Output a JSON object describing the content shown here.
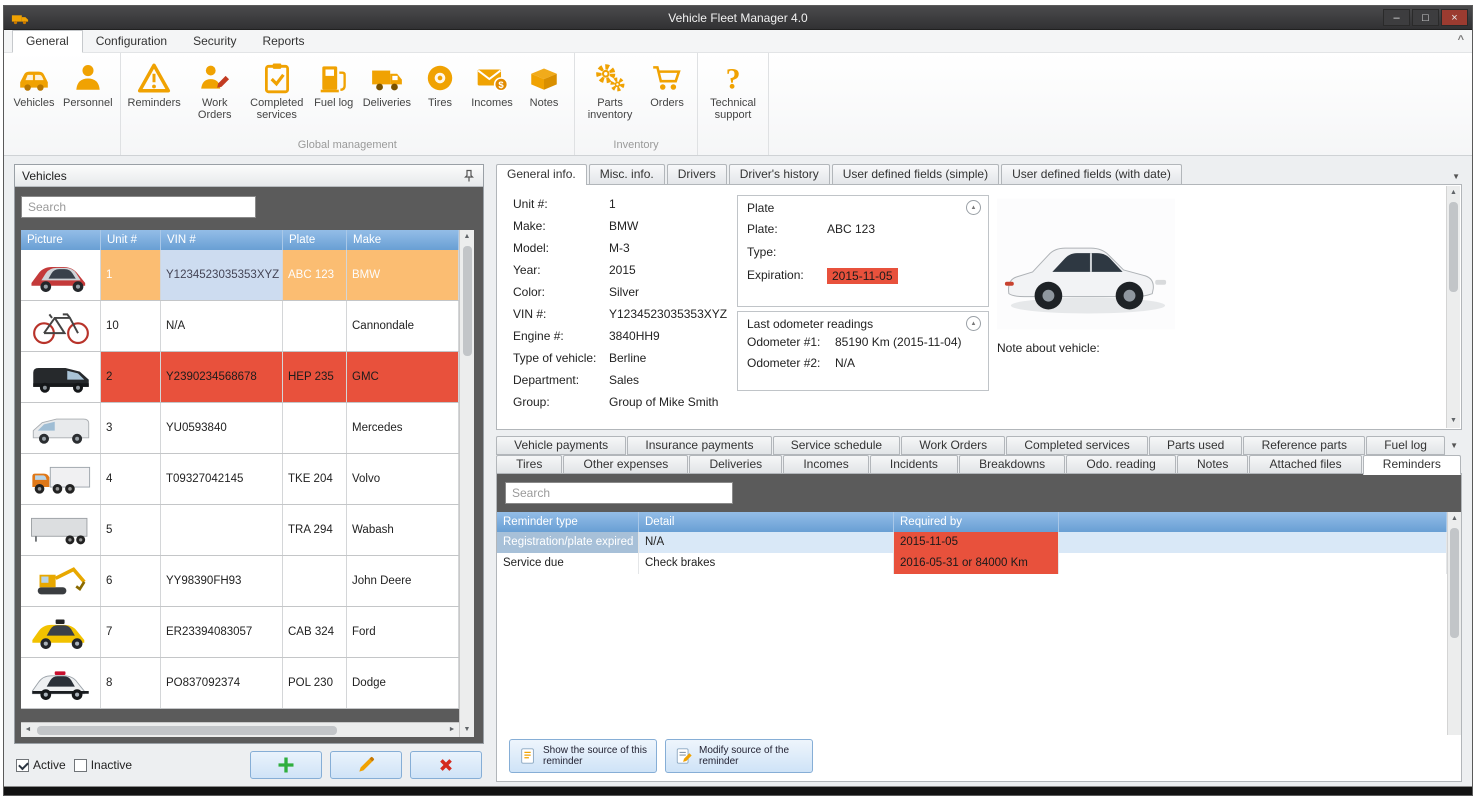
{
  "icons": {
    "chevron_up": "^",
    "dropdown": "▼",
    "scroll_up": "▲",
    "scroll_down": "▼",
    "scroll_left": "◄",
    "scroll_right": "►",
    "collapse_up": "▲"
  },
  "colors": {
    "accent_orange": "#F0A202",
    "alert_red": "#E8513C",
    "selection_orange": "#FBBD72",
    "header_blue": "#74A9DC",
    "selected_row_blue": "#D9E8F7"
  },
  "window": {
    "title": "Vehicle Fleet Manager 4.0",
    "controls": {
      "minimize": "–",
      "maximize": "□",
      "close": "×"
    }
  },
  "menu": {
    "tabs": [
      {
        "label": "General",
        "active": true
      },
      {
        "label": "Configuration",
        "active": false
      },
      {
        "label": "Security",
        "active": false
      },
      {
        "label": "Reports",
        "active": false
      }
    ]
  },
  "ribbon": {
    "groups": [
      {
        "label": "",
        "buttons": [
          {
            "label": "Vehicles",
            "icon": "car"
          },
          {
            "label": "Personnel",
            "icon": "person"
          }
        ]
      },
      {
        "label": "Global management",
        "buttons": [
          {
            "label": "Reminders",
            "icon": "warning"
          },
          {
            "label": "Work Orders",
            "icon": "work-orders"
          },
          {
            "label": "Completed services",
            "icon": "clipboard-check"
          },
          {
            "label": "Fuel log",
            "icon": "fuel-pump"
          },
          {
            "label": "Deliveries",
            "icon": "delivery-truck"
          },
          {
            "label": "Tires",
            "icon": "tire"
          },
          {
            "label": "Incomes",
            "icon": "income"
          },
          {
            "label": "Notes",
            "icon": "note"
          }
        ]
      },
      {
        "label": "Inventory",
        "buttons": [
          {
            "label": "Parts inventory",
            "icon": "gears"
          },
          {
            "label": "Orders",
            "icon": "cart"
          }
        ]
      },
      {
        "label": "",
        "buttons": [
          {
            "label": "Technical support",
            "icon": "question"
          }
        ]
      }
    ]
  },
  "vehicles_panel": {
    "title": "Vehicles",
    "search_placeholder": "Search",
    "columns": [
      "Picture",
      "Unit #",
      "VIN #",
      "Plate",
      "Make"
    ],
    "rows": [
      {
        "unit": "1",
        "vin": "Y1234523035353XYZ",
        "plate": "ABC 123",
        "make": "BMW",
        "state": "selected",
        "icon": "t-car"
      },
      {
        "unit": "10",
        "vin": "N/A",
        "plate": "",
        "make": "Cannondale",
        "state": "normal",
        "icon": "t-bike"
      },
      {
        "unit": "2",
        "vin": "Y2390234568678",
        "plate": "HEP 235",
        "make": "GMC",
        "state": "alert",
        "icon": "t-van-dark"
      },
      {
        "unit": "3",
        "vin": "YU0593840",
        "plate": "",
        "make": "Mercedes",
        "state": "normal",
        "icon": "t-van-white"
      },
      {
        "unit": "4",
        "vin": "T09327042145",
        "plate": "TKE 204",
        "make": "Volvo",
        "state": "normal",
        "icon": "t-truck"
      },
      {
        "unit": "5",
        "vin": "",
        "plate": "TRA 294",
        "make": "Wabash",
        "state": "normal",
        "icon": "t-trailer"
      },
      {
        "unit": "6",
        "vin": "YY98390FH93",
        "plate": "",
        "make": "John Deere",
        "state": "normal",
        "icon": "t-excavator"
      },
      {
        "unit": "7",
        "vin": "ER23394083057",
        "plate": "CAB 324",
        "make": "Ford",
        "state": "normal",
        "icon": "t-taxi"
      },
      {
        "unit": "8",
        "vin": "PO837092374",
        "plate": "POL 230",
        "make": "Dodge",
        "state": "normal",
        "icon": "t-police"
      }
    ],
    "filters": {
      "active_label": "Active",
      "inactive_label": "Inactive",
      "active_checked": true,
      "inactive_checked": false
    }
  },
  "detail_tabs": [
    {
      "label": "General info.",
      "active": true
    },
    {
      "label": "Misc. info.",
      "active": false
    },
    {
      "label": "Drivers",
      "active": false
    },
    {
      "label": "Driver's history",
      "active": false
    },
    {
      "label": "User defined fields (simple)",
      "active": false
    },
    {
      "label": "User defined fields (with date)",
      "active": false
    }
  ],
  "general_info": {
    "fields": [
      {
        "label": "Unit #:",
        "value": "1"
      },
      {
        "label": "Make:",
        "value": "BMW"
      },
      {
        "label": "Model:",
        "value": "M-3"
      },
      {
        "label": "Year:",
        "value": "2015"
      },
      {
        "label": "Color:",
        "value": "Silver"
      },
      {
        "label": "VIN #:",
        "value": "Y1234523035353XYZ"
      },
      {
        "label": "Engine #:",
        "value": "3840HH9"
      },
      {
        "label": "Type of vehicle:",
        "value": "Berline"
      },
      {
        "label": "Department:",
        "value": "Sales"
      },
      {
        "label": "Group:",
        "value": "Group of Mike Smith"
      }
    ],
    "plate_box": {
      "title": "Plate",
      "rows": [
        {
          "label": "Plate:",
          "value": "ABC 123",
          "highlight": false
        },
        {
          "label": "Type:",
          "value": "",
          "highlight": false
        },
        {
          "label": "Expiration:",
          "value": "2015-11-05",
          "highlight": true
        }
      ]
    },
    "odometer_box": {
      "title": "Last odometer readings",
      "rows": [
        {
          "label": "Odometer #1:",
          "value": "85190 Km (2015-11-04)"
        },
        {
          "label": "Odometer #2:",
          "value": "N/A"
        }
      ]
    },
    "note_label": "Note about vehicle:"
  },
  "sub_tabs": {
    "row1": [
      {
        "label": "Vehicle payments"
      },
      {
        "label": "Insurance payments"
      },
      {
        "label": "Service schedule"
      },
      {
        "label": "Work Orders"
      },
      {
        "label": "Completed services"
      },
      {
        "label": "Parts used"
      },
      {
        "label": "Reference parts"
      },
      {
        "label": "Fuel log"
      }
    ],
    "row2": [
      {
        "label": "Tires"
      },
      {
        "label": "Other expenses"
      },
      {
        "label": "Deliveries"
      },
      {
        "label": "Incomes"
      },
      {
        "label": "Incidents"
      },
      {
        "label": "Breakdowns"
      },
      {
        "label": "Odo. reading"
      },
      {
        "label": "Notes"
      },
      {
        "label": "Attached files"
      },
      {
        "label": "Reminders",
        "active": true
      }
    ]
  },
  "reminders": {
    "search_placeholder": "Search",
    "columns": [
      "Reminder type",
      "Detail",
      "Required by",
      ""
    ],
    "rows": [
      {
        "type": "Registration/plate expired",
        "detail": "N/A",
        "required": "2015-11-05",
        "selected": true
      },
      {
        "type": "Service due",
        "detail": "Check brakes",
        "required": "2016-05-31 or 84000 Km",
        "selected": false
      }
    ],
    "footer_buttons": [
      {
        "label": "Show the source of this reminder",
        "icon": "doc"
      },
      {
        "label": "Modify source of the reminder",
        "icon": "doc-edit"
      }
    ]
  }
}
